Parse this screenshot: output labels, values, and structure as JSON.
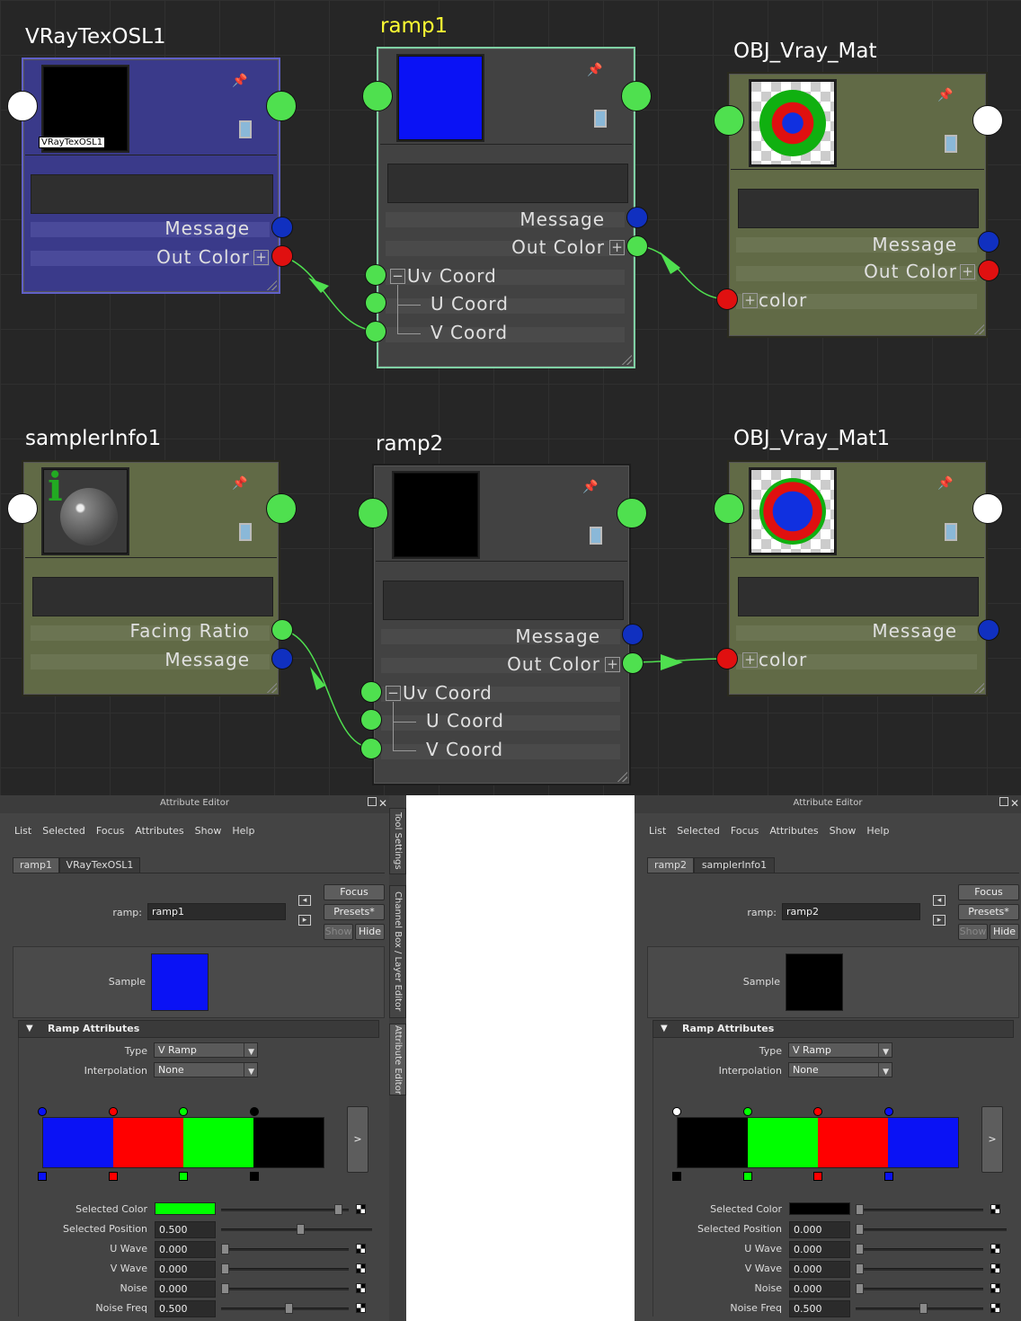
{
  "graph": {
    "nodes": [
      {
        "title": "VRayTexOSL1",
        "swatch_label": "VRayTexOSL1",
        "attrs": [
          "Message",
          "Out Color"
        ]
      },
      {
        "title": "ramp1",
        "attrs": [
          "Message",
          "Out Color",
          "Uv Coord",
          "U Coord",
          "V Coord"
        ]
      },
      {
        "title": "OBJ_Vray_Mat",
        "attrs": [
          "Message",
          "Out Color",
          "color"
        ]
      },
      {
        "title": "samplerInfo1",
        "attrs": [
          "Facing Ratio",
          "Message"
        ]
      },
      {
        "title": "ramp2",
        "attrs": [
          "Message",
          "Out Color",
          "Uv Coord",
          "U Coord",
          "V Coord"
        ]
      },
      {
        "title": "OBJ_Vray_Mat1",
        "attrs": [
          "Message",
          "color"
        ]
      }
    ],
    "colors": {
      "selected_title": "#ffff33",
      "port_green": "#4fe04f",
      "port_red": "#e01010",
      "port_blue": "#1030c0",
      "connection": "#4fe04f"
    }
  },
  "editors": [
    {
      "window_title": "Attribute Editor",
      "menu": [
        "List",
        "Selected",
        "Focus",
        "Attributes",
        "Show",
        "Help"
      ],
      "tabs": [
        "ramp1",
        "VRayTexOSL1"
      ],
      "node_type_label": "ramp:",
      "node_name": "ramp1",
      "buttons": {
        "focus": "Focus",
        "presets": "Presets*",
        "show": "Show",
        "hide": "Hide"
      },
      "sample_label": "Sample",
      "sample_color": "#0a12f5",
      "section": "Ramp Attributes",
      "type_label": "Type",
      "type_value": "V Ramp",
      "interp_label": "Interpolation",
      "interp_value": "None",
      "ramp_colors": [
        "#0a12f5",
        "#ff0000",
        "#00ff00",
        "#000000"
      ],
      "arrow": ">",
      "fields": [
        {
          "label": "Selected Color",
          "value": ""
        },
        {
          "label": "Selected Position",
          "value": "0.500"
        },
        {
          "label": "U Wave",
          "value": "0.000"
        },
        {
          "label": "V Wave",
          "value": "0.000"
        },
        {
          "label": "Noise",
          "value": "0.000"
        },
        {
          "label": "Noise Freq",
          "value": "0.500"
        }
      ],
      "selected_color": "#00ff00"
    },
    {
      "window_title": "Attribute Editor",
      "menu": [
        "List",
        "Selected",
        "Focus",
        "Attributes",
        "Show",
        "Help"
      ],
      "tabs": [
        "ramp2",
        "samplerInfo1"
      ],
      "node_type_label": "ramp:",
      "node_name": "ramp2",
      "buttons": {
        "focus": "Focus",
        "presets": "Presets*",
        "show": "Show",
        "hide": "Hide"
      },
      "sample_label": "Sample",
      "sample_color": "#000000",
      "section": "Ramp Attributes",
      "type_label": "Type",
      "type_value": "V Ramp",
      "interp_label": "Interpolation",
      "interp_value": "None",
      "ramp_colors": [
        "#000000",
        "#00ff00",
        "#ff0000",
        "#0a12f5"
      ],
      "arrow": ">",
      "fields": [
        {
          "label": "Selected Color",
          "value": ""
        },
        {
          "label": "Selected Position",
          "value": "0.000"
        },
        {
          "label": "U Wave",
          "value": "0.000"
        },
        {
          "label": "V Wave",
          "value": "0.000"
        },
        {
          "label": "Noise",
          "value": "0.000"
        },
        {
          "label": "Noise Freq",
          "value": "0.500"
        }
      ],
      "selected_color": "#000000"
    }
  ],
  "side_tabs": [
    "Tool Settings",
    "Channel Box / Layer Editor",
    "Attribute Editor"
  ]
}
